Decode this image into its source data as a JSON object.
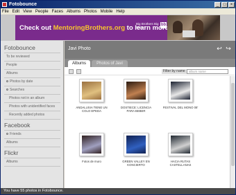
{
  "window": {
    "title": "Fotobounce"
  },
  "menu": [
    "File",
    "Edit",
    "View",
    "People",
    "Faces",
    "Albums",
    "Photos",
    "Mobile",
    "Help"
  ],
  "ad": {
    "text_before": "Check out ",
    "highlight": "MentoringBrothers.org",
    "text_after": " to learn more",
    "logo_text": "Big Brothers Big Sisters",
    "logo_mark": "bb"
  },
  "sidebar": {
    "sections": [
      {
        "title": "Fotobounce",
        "items": [
          {
            "label": "To be reviewed",
            "type": "item"
          },
          {
            "label": "People",
            "type": "item"
          },
          {
            "label": "Albums",
            "type": "item"
          },
          {
            "label": "Photos by date",
            "type": "radio"
          },
          {
            "label": "Searches",
            "type": "radio"
          },
          {
            "label": "Photos not in an album",
            "type": "sub"
          },
          {
            "label": "Photos with unidentified faces",
            "type": "sub"
          },
          {
            "label": "Recently added photos",
            "type": "sub"
          }
        ]
      },
      {
        "title": "Facebook",
        "items": [
          {
            "label": "Friends",
            "type": "radio"
          },
          {
            "label": "Albums",
            "type": "item"
          }
        ]
      },
      {
        "title": "Flickr",
        "items": [
          {
            "label": "Albums",
            "type": "item"
          }
        ]
      }
    ]
  },
  "main": {
    "album_title": "Javi Photo",
    "nav_back": "↩",
    "nav_forward": "↪",
    "tabs": [
      "Albums",
      "Photos of Javi"
    ],
    "filter_label": "Filter by name",
    "filter_placeholder": "album name",
    "albums": [
      {
        "caption": "ANDALUSIA TIENE UN COLO EPEDA",
        "colors": [
          "#9a7040",
          "#e0c080"
        ]
      },
      {
        "caption": "DOSTIECE: LICENCIA PARA BEBER",
        "colors": [
          "#2a1a10",
          "#c08050"
        ]
      },
      {
        "caption": "FESTIVAL DEL MONO 08'",
        "colors": [
          "#1a2030",
          "#e8e8e8"
        ]
      },
      {
        "caption": "Fotos de muro",
        "colors": [
          "#302020",
          "#a0a0c0"
        ]
      },
      {
        "caption": "GREEN VALLEY EN KONCIERTO",
        "colors": [
          "#102050",
          "#3060c0"
        ]
      },
      {
        "caption": "HACIA RUTAS CASTELLANAS",
        "colors": [
          "#202830",
          "#d0d0d0"
        ]
      }
    ]
  },
  "status": {
    "text": "You have 55 photos in Fotobounce."
  }
}
